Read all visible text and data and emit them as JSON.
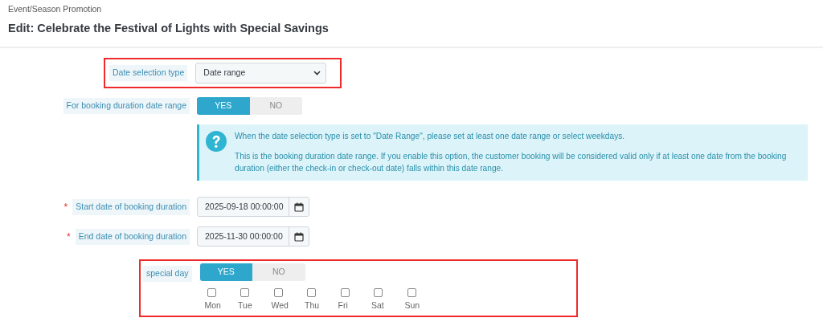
{
  "breadcrumb": "Event/Season Promotion",
  "title": "Edit: Celebrate the Festival of Lights with Special Savings",
  "form": {
    "rows": [
      {
        "kind": "select",
        "label": "Date selection type",
        "value": "Date range",
        "highlighted": true
      },
      {
        "kind": "toggle",
        "label": "For booking duration date range",
        "highlighted": false,
        "options": [
          {
            "label": "YES",
            "selected": true
          },
          {
            "label": "NO",
            "selected": false
          }
        ]
      },
      {
        "kind": "alert",
        "paragraphs": [
          "When the date selection type is set to \"Date Range\", please set at least one date range or select weekdays.",
          "This is the booking duration date range. If you enable this option, the customer booking will be considered valid only if at least one date from the booking duration (either the check-in or check-out date) falls within this date range."
        ]
      },
      {
        "kind": "date",
        "required_mark": "*",
        "label": "Start date of booking duration",
        "value": "2025-09-18 00:00:00",
        "highlighted": false
      },
      {
        "kind": "date",
        "required_mark": "*",
        "label": "End date of booking duration",
        "value": "2025-11-30 00:00:00",
        "highlighted": false
      },
      {
        "kind": "toggle",
        "label": "special day",
        "highlighted": true,
        "options": [
          {
            "label": "YES",
            "selected": true
          },
          {
            "label": "NO",
            "selected": false
          }
        ],
        "days": [
          {
            "label": "Mon",
            "checked": false
          },
          {
            "label": "Tue",
            "checked": false
          },
          {
            "label": "Wed",
            "checked": false
          },
          {
            "label": "Thu",
            "checked": false
          },
          {
            "label": "Fri",
            "checked": false
          },
          {
            "label": "Sat",
            "checked": false
          },
          {
            "label": "Sun",
            "checked": false
          }
        ]
      }
    ]
  }
}
